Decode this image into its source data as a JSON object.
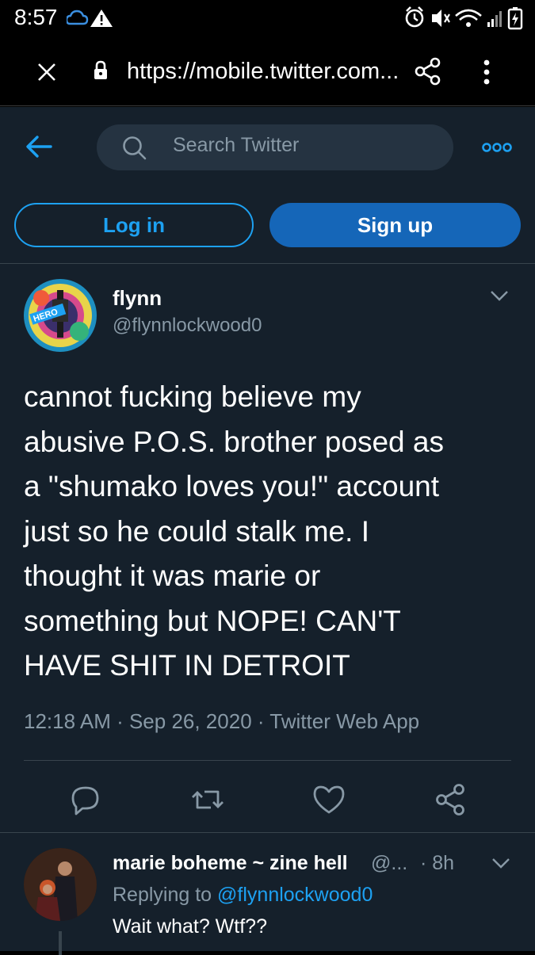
{
  "status_bar": {
    "time": "8:57",
    "icons_left": [
      "cloud-icon",
      "warning-icon"
    ],
    "icons_right": [
      "alarm-icon",
      "mute-icon",
      "wifi-icon",
      "signal-icon",
      "battery-icon"
    ]
  },
  "browser": {
    "url": "https://mobile.twitter.com...",
    "icons": [
      "close-icon",
      "lock-icon",
      "share-icon",
      "more-vertical-icon"
    ]
  },
  "twitter": {
    "search_placeholder": "Search Twitter",
    "login_label": "Log in",
    "signup_label": "Sign up",
    "accent_color": "#1da1f2",
    "background_color": "#15202b"
  },
  "tweet": {
    "name": "flynn",
    "handle": "@flynnlockwood0",
    "avatar_text": "HERO",
    "text_lines": [
      "cannot fucking believe my",
      "abusive P.O.S. brother posed as",
      "a \"shumako loves you!\" account",
      "just so he could stalk me. I",
      "thought it was marie or",
      "something but NOPE! CAN'T",
      "HAVE SHIT IN DETROIT"
    ],
    "meta": "12:18 AM · Sep 26, 2020 · Twitter Web App",
    "actions": [
      "reply-icon",
      "retweet-icon",
      "like-icon",
      "share-icon"
    ]
  },
  "reply": {
    "name": "marie boheme ~ zine hell",
    "handle": "@...",
    "time": "· 8h",
    "replying_prefix": "Replying to ",
    "replying_mention": "@flynnlockwood0",
    "text": "Wait what? Wtf??"
  }
}
